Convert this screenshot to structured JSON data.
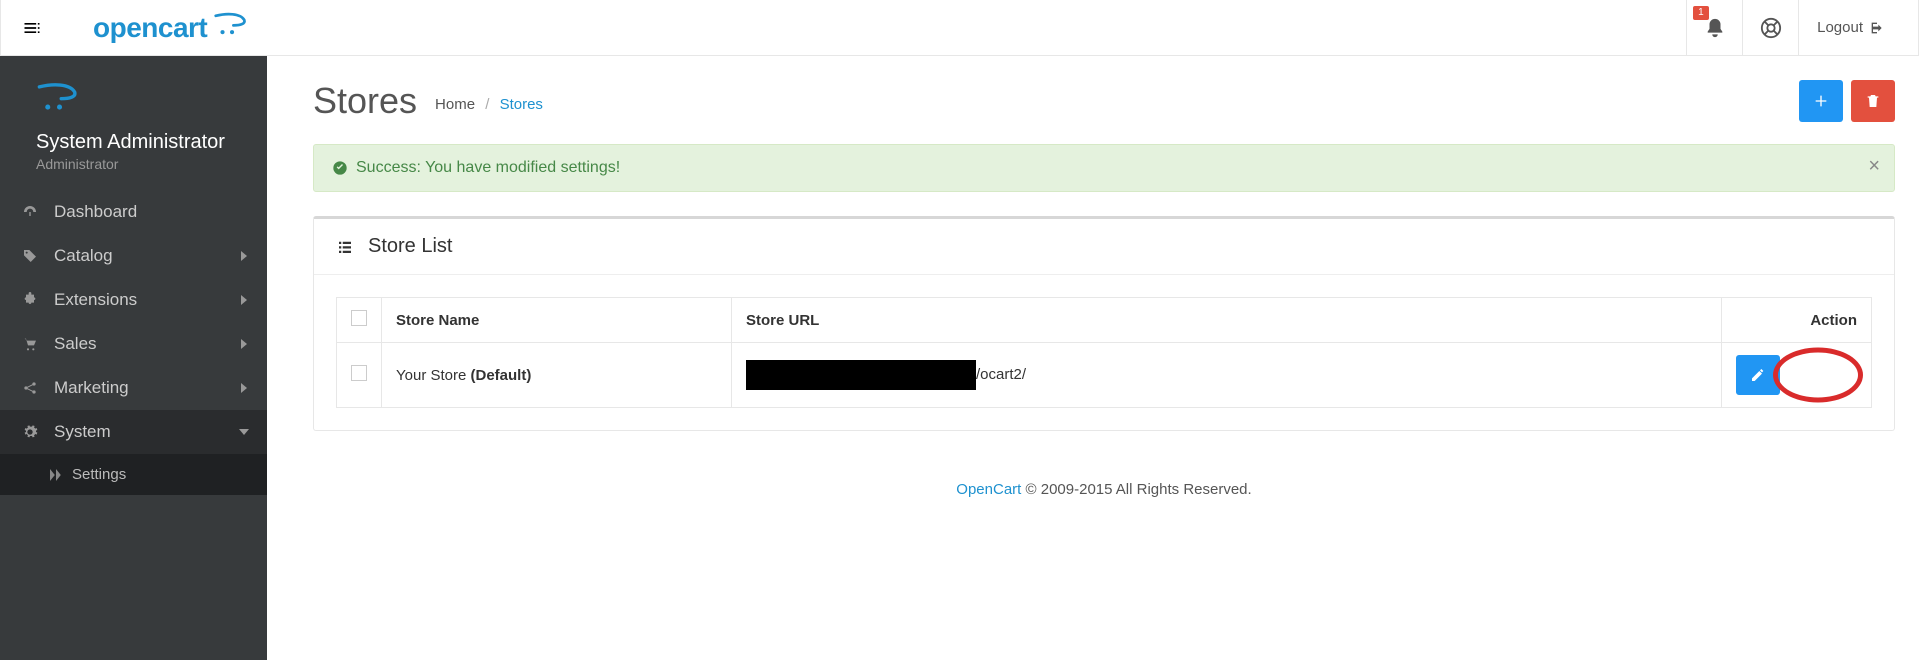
{
  "header": {
    "brand": "opencart",
    "notif_badge": "1",
    "logout_label": "Logout"
  },
  "sidebar": {
    "profile_name": "System Administrator",
    "profile_role": "Administrator",
    "items": [
      {
        "label": "Dashboard",
        "icon": "dashboard",
        "expandable": false
      },
      {
        "label": "Catalog",
        "icon": "tag",
        "expandable": true
      },
      {
        "label": "Extensions",
        "icon": "puzzle",
        "expandable": true
      },
      {
        "label": "Sales",
        "icon": "cart",
        "expandable": true
      },
      {
        "label": "Marketing",
        "icon": "share",
        "expandable": true
      },
      {
        "label": "System",
        "icon": "gear",
        "expandable": true,
        "active": true
      }
    ],
    "system_sub": [
      {
        "label": "Settings"
      }
    ]
  },
  "page": {
    "title": "Stores",
    "breadcrumb": {
      "home": "Home",
      "current": "Stores"
    }
  },
  "alert": {
    "text": "Success: You have modified settings!"
  },
  "panel": {
    "title": "Store List"
  },
  "table": {
    "columns": {
      "name": "Store Name",
      "url": "Store URL",
      "action": "Action"
    },
    "rows": [
      {
        "name": "Your Store ",
        "name_suffix": "(Default)",
        "url_suffix": "/ocart2/"
      }
    ]
  },
  "footer": {
    "link": "OpenCart",
    "rest": " © 2009-2015 All Rights Reserved."
  }
}
